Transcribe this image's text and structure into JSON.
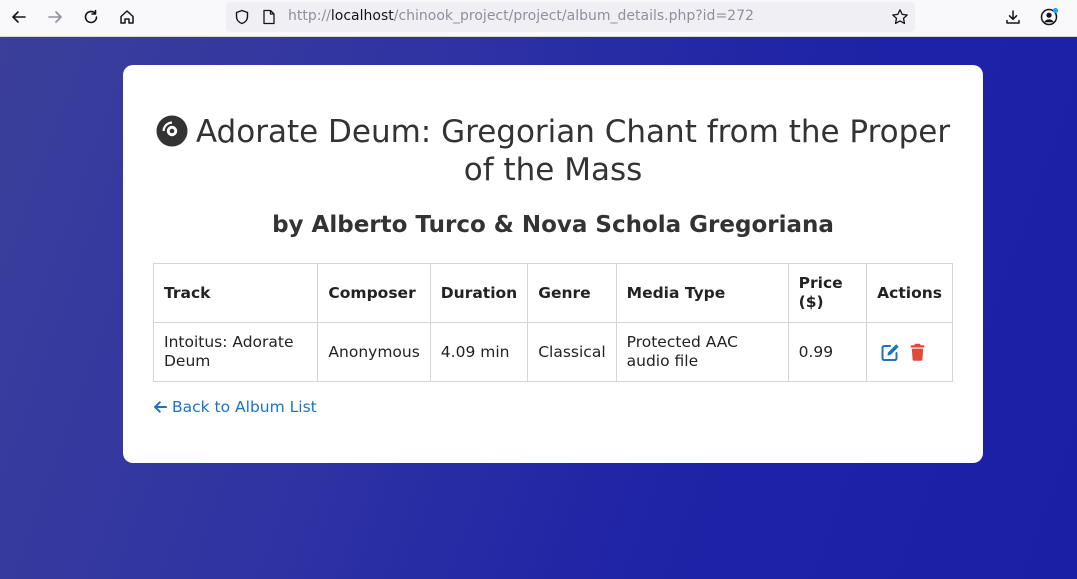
{
  "browser": {
    "url_prefix": "http://",
    "url_host": "localhost",
    "url_path": "/chinook_project/project/album_details.php?id=272"
  },
  "album": {
    "title": "Adorate Deum: Gregorian Chant from the Proper of the Mass",
    "artist_line": "by Alberto Turco & Nova Schola Gregoriana"
  },
  "table": {
    "headers": {
      "track": "Track",
      "composer": "Composer",
      "duration": "Duration",
      "genre": "Genre",
      "media_type": "Media Type",
      "price": "Price ($)",
      "actions": "Actions"
    },
    "rows": [
      {
        "track": "Intoitus: Adorate Deum",
        "composer": "Anonymous",
        "duration": "4.09 min",
        "genre": "Classical",
        "media_type": "Protected AAC audio file",
        "price": "0.99"
      }
    ]
  },
  "back_link": "Back to Album List",
  "colors": {
    "edit": "#1a73c9",
    "delete": "#e0493c",
    "link": "#1a73c9"
  },
  "icons": [
    "back-arrow-icon",
    "forward-arrow-icon",
    "reload-icon",
    "home-icon",
    "shield-icon",
    "page-icon",
    "bookmark-star-icon",
    "download-icon",
    "account-icon",
    "compact-disc-icon",
    "edit-icon",
    "trash-icon",
    "arrow-left-icon"
  ]
}
